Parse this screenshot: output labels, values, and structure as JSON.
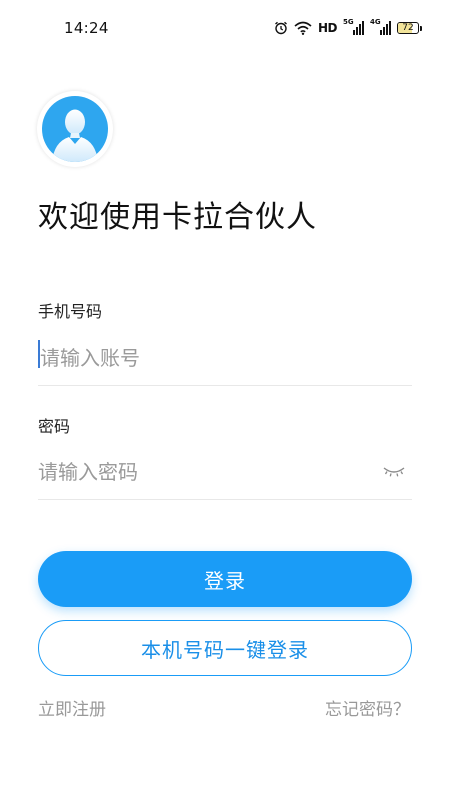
{
  "status_bar": {
    "time": "14:24",
    "icons": [
      "alarm-icon",
      "wifi-icon",
      "hd-icon",
      "signal-5g-icon",
      "signal-4g-icon",
      "battery-icon"
    ],
    "hd_label": "HD",
    "sim1_network": "5G",
    "sim2_network": "4G",
    "battery_level": "72",
    "battery_fraction": 0.72
  },
  "header": {
    "avatar_icon": "user-avatar-icon",
    "welcome_title": "欢迎使用卡拉合伙人"
  },
  "form": {
    "phone_label": "手机号码",
    "phone_placeholder": "请输入账号",
    "phone_value": "",
    "password_label": "密码",
    "password_placeholder": "请输入密码",
    "password_value": "",
    "password_toggle_icon": "eye-closed-icon"
  },
  "actions": {
    "login_label": "登录",
    "one_key_login_label": "本机号码一键登录",
    "register_label": "立即注册",
    "forgot_password_label": "忘记密码？"
  },
  "colors": {
    "primary": "#1a9cf7",
    "avatar_bg": "#2ea6ef",
    "muted_text": "#999999",
    "placeholder": "#9a9a9a"
  }
}
